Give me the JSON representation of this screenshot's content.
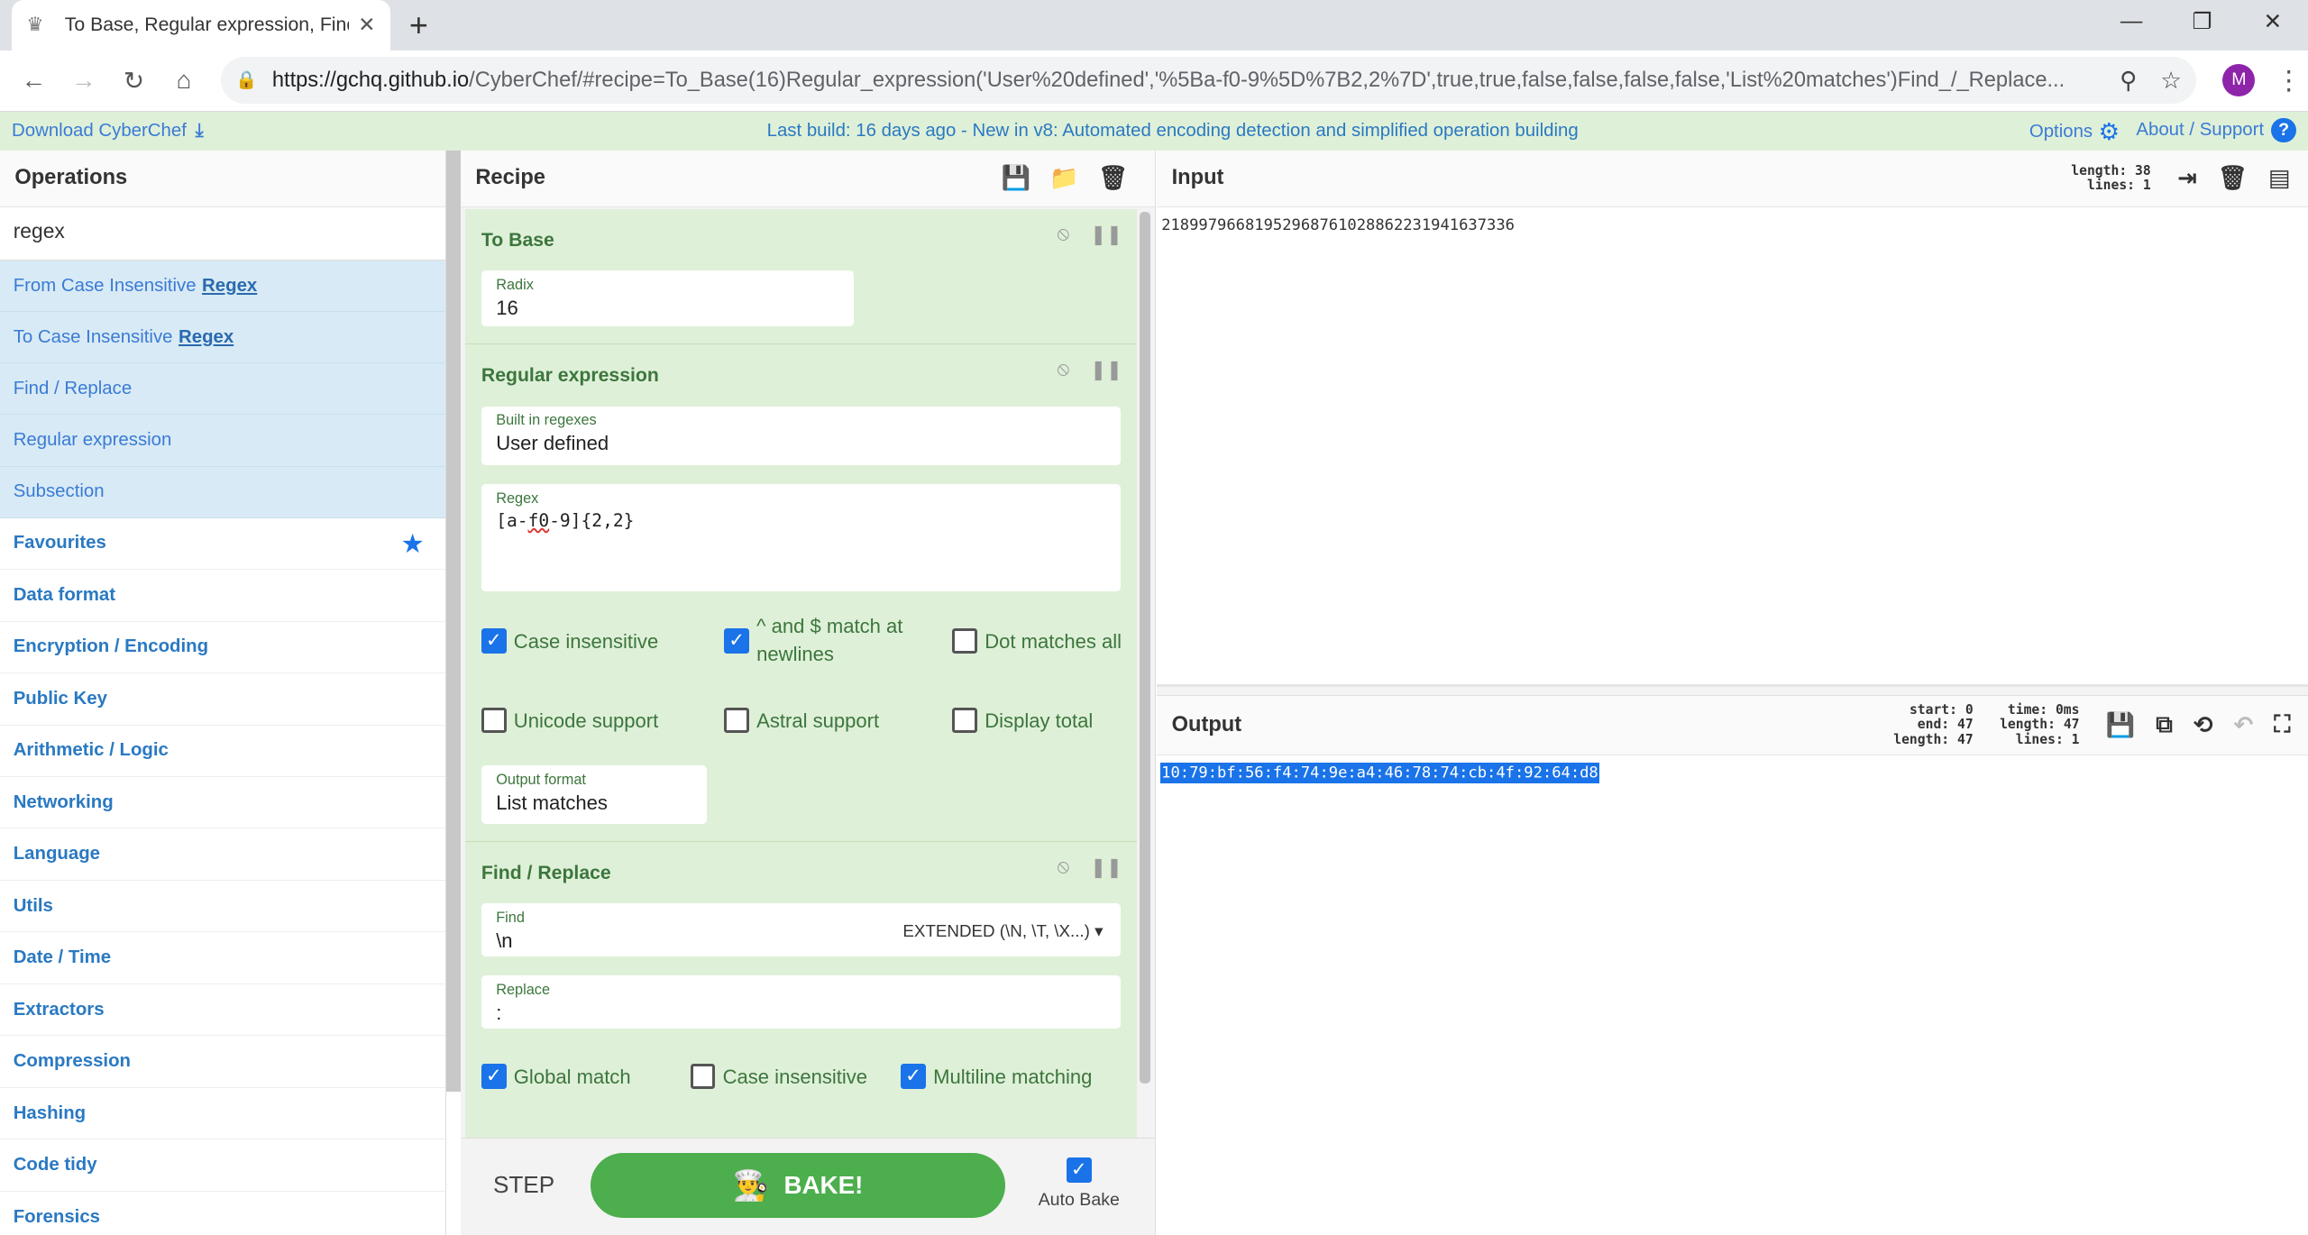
{
  "browser": {
    "tab_title": "To Base, Regular expression, Find",
    "url_host": "https://gchq.github.io",
    "url_path": "/CyberChef/#recipe=To_Base(16)Regular_expression('User%20defined','%5Ba-f0-9%5D%7B2,2%7D',true,true,false,false,false,false,'List%20matches')Find_/_Replace...",
    "avatar_letter": "M"
  },
  "banner": {
    "download": "Download CyberChef",
    "news": "Last build: 16 days ago - New in v8: Automated encoding detection and simplified operation building",
    "options": "Options",
    "about": "About / Support"
  },
  "operations": {
    "title": "Operations",
    "search_value": "regex",
    "results": [
      {
        "pre": "From Case Insensitive",
        "match": "Regex"
      },
      {
        "pre": "To Case Insensitive",
        "match": "Regex"
      },
      {
        "pre": "Find / Replace",
        "match": ""
      },
      {
        "pre": "Regular expression",
        "match": ""
      },
      {
        "pre": "Subsection",
        "match": ""
      }
    ],
    "categories": [
      "Favourites",
      "Data format",
      "Encryption / Encoding",
      "Public Key",
      "Arithmetic / Logic",
      "Networking",
      "Language",
      "Utils",
      "Date / Time",
      "Extractors",
      "Compression",
      "Hashing",
      "Code tidy",
      "Forensics"
    ]
  },
  "recipe": {
    "title": "Recipe",
    "to_base": {
      "title": "To Base",
      "radix_label": "Radix",
      "radix": "16"
    },
    "regex": {
      "title": "Regular expression",
      "builtin_label": "Built in regexes",
      "builtin": "User defined",
      "regex_label": "Regex",
      "regex_a": "[a-",
      "regex_b": "f0",
      "regex_c": "-9]{2,2}",
      "case_insensitive": "Case insensitive",
      "multiline_1": "^ and $ match at",
      "multiline_2": "newlines",
      "dot_all": "Dot matches all",
      "unicode": "Unicode support",
      "astral": "Astral support",
      "display_total": "Display total",
      "output_format_label": "Output format",
      "output_format": "List matches"
    },
    "find_replace": {
      "title": "Find / Replace",
      "find_label": "Find",
      "find": "\\n",
      "find_mode": "EXTENDED (\\N, \\T, \\X...)",
      "replace_label": "Replace",
      "replace": ":",
      "global": "Global match",
      "case_insensitive": "Case insensitive",
      "multiline": "Multiline matching"
    },
    "step": "STEP",
    "bake": "BAKE!",
    "auto_bake": "Auto Bake"
  },
  "input": {
    "title": "Input",
    "length_label": "length:",
    "length": "38",
    "lines_label": "lines:",
    "lines": "1",
    "text": "21899796681952968761028862231941637336"
  },
  "output": {
    "title": "Output",
    "start_label": "start:",
    "start": "0",
    "end_label": "end:",
    "end": "47",
    "length_label": "length:",
    "length": "47",
    "time_label": "time:",
    "time": "0ms",
    "olength_label": "length:",
    "olength": "47",
    "lines_label": "lines:",
    "lines": "1",
    "text": "10:79:bf:56:f4:74:9e:a4:46:78:74:cb:4f:92:64:d8"
  }
}
